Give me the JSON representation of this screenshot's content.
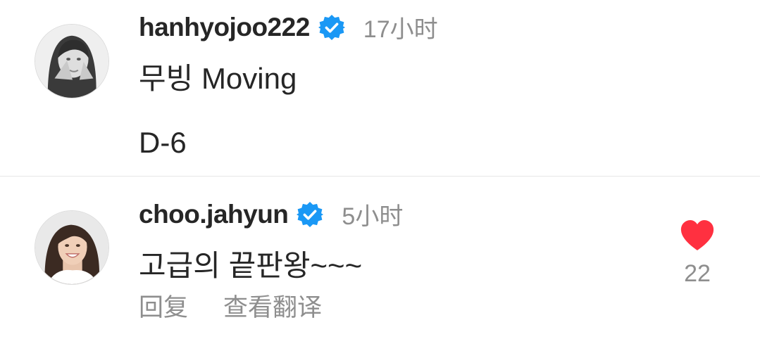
{
  "caption": {
    "username": "hanhyojoo222",
    "verified_icon": "verified-badge-icon",
    "time": "17小时",
    "lines": [
      "무빙 Moving",
      "D-6"
    ]
  },
  "comment": {
    "username": "choo.jahyun",
    "verified_icon": "verified-badge-icon",
    "time": "5小时",
    "text": "고급의 끝판왕~~~",
    "reply_label": "回复",
    "translate_label": "查看翻译",
    "like_icon": "heart-filled-icon",
    "like_count": "22"
  },
  "colors": {
    "verified": "#1a98f5",
    "like": "#ff3040",
    "secondary_text": "#8e8e8e",
    "primary_text": "#262626"
  }
}
